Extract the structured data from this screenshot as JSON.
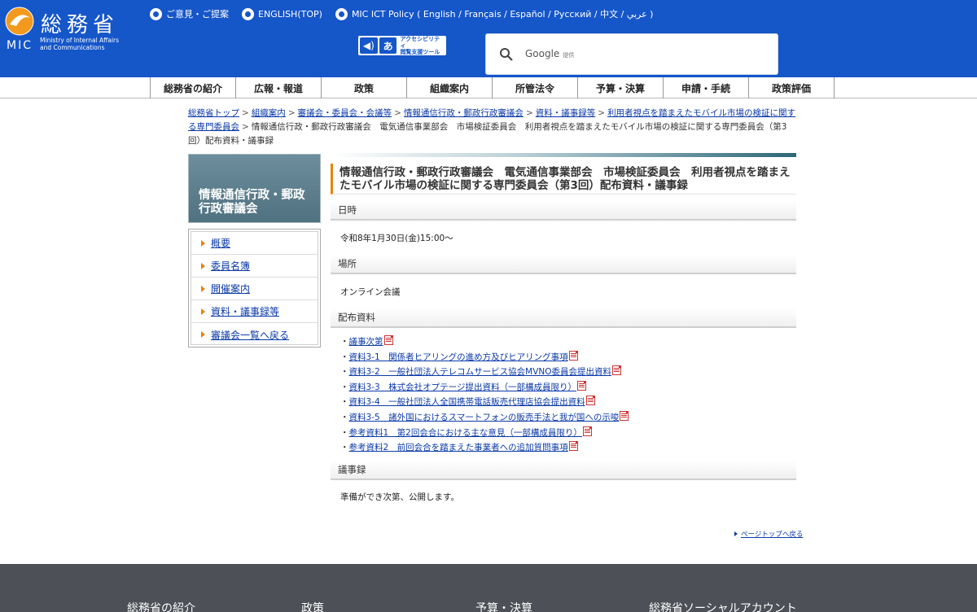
{
  "header": {
    "logo_kanji": "総務省",
    "logo_mic": "MIC",
    "logo_en_line1": "Ministry of Internal Affairs",
    "logo_en_line2": "and Communications",
    "brand_color": "#1556c9",
    "toplinks": [
      {
        "label": "ご意見・ご提案"
      },
      {
        "label": "ENGLISH(TOP)"
      },
      {
        "label": "MIC ICT Policy ( English / Français / Español / Русский / 中文 / عربي )"
      }
    ],
    "accessibility": {
      "line1": "アクセシビリティ",
      "line2": "閲覧支援ツール",
      "speaker_icon": "speaker-icon",
      "aa_icon": "あ"
    },
    "search": {
      "brand": "Google",
      "suffix": "提供",
      "icon": "search-icon"
    }
  },
  "global_nav": [
    "総務省の紹介",
    "広報・報道",
    "政策",
    "組織案内",
    "所管法令",
    "予算・決算",
    "申請・手続",
    "政策評価"
  ],
  "breadcrumb": {
    "links": [
      "総務省トップ",
      "組織案内",
      "審議会・委員会・会議等",
      "情報通信行政・郵政行政審議会",
      "資料・議事録等",
      "利用者視点を踏まえたモバイル市場の検証に関する専門委員会"
    ],
    "current": "情報通信行政・郵政行政審議会　電気通信事業部会　市場検証委員会　利用者視点を踏まえたモバイル市場の検証に関する専門委員会（第3回）配布資料・議事録"
  },
  "sidebar": {
    "title": "情報通信行政・郵政行政審議会",
    "items": [
      {
        "label": "概要"
      },
      {
        "label": "委員名簿"
      },
      {
        "label": "開催案内"
      },
      {
        "label": "資料・議事録等"
      },
      {
        "label": "審議会一覧へ戻る"
      }
    ],
    "accent_color": "#e8820d"
  },
  "content": {
    "title": "情報通信行政・郵政行政審議会　電気通信事業部会　市場検証委員会　利用者視点を踏まえたモバイル市場の検証に関する専門委員会（第3回）配布資料・議事録",
    "date_heading": "日時",
    "date_value": "令和8年1月30日(金)15:00～",
    "place_heading": "場所",
    "place_value": "オンライン会議",
    "docs_heading": "配布資料",
    "docs": [
      "議事次第",
      "資料3-1　関係者ヒアリングの進め方及びヒアリング事項",
      "資料3-2　一般社団法人テレコムサービス協会MVNO委員会提出資料",
      "資料3-3　株式会社オプテージ提出資料（一部構成員限り）",
      "資料3-4　一般社団法人全国携帯電話販売代理店協会提出資料",
      "資料3-5　諸外国におけるスマートフォンの販売手法と我が国への示唆",
      "参考資料1　第2回会合における主な意見（一部構成員限り）",
      "参考資料2　前回会合を踏まえた事業者への追加質問事項"
    ],
    "minutes_heading": "議事録",
    "minutes_value": "準備ができ次第、公開します。",
    "pagetop": "ページトップへ戻る"
  },
  "footer": {
    "items": [
      "総務省の紹介",
      "政策",
      "予算・決算",
      "総務省ソーシャルアカウント"
    ]
  }
}
